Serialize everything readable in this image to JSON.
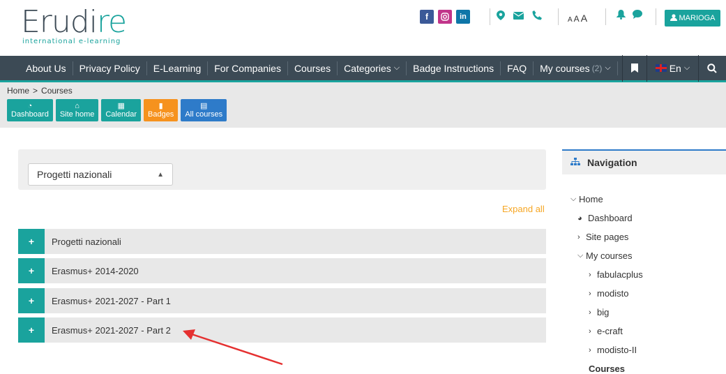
{
  "header": {
    "logo_main": "Erudire",
    "logo_sub": "international e-learning",
    "font_sizes_label": "AAA",
    "user_button": "MARIOGA"
  },
  "social_icons": [
    "facebook-icon",
    "instagram-icon",
    "linkedin-icon"
  ],
  "nav": {
    "items": [
      "About Us",
      "Privacy Policy",
      "E-Learning",
      "For Companies",
      "Courses",
      "Categories",
      "Badge Instructions",
      "FAQ",
      "My courses"
    ],
    "my_courses_count": "(2)",
    "language": "En"
  },
  "breadcrumb": {
    "home": "Home",
    "sep": ">",
    "current": "Courses"
  },
  "quick_links": {
    "dashboard": "Dashboard",
    "site_home": "Site home",
    "calendar": "Calendar",
    "badges": "Badges",
    "all_courses": "All courses"
  },
  "category_select": {
    "value": "Progetti nazionali"
  },
  "expand_all": "Expand all",
  "categories": [
    "Progetti nazionali",
    "Erasmus+ 2014-2020",
    "Erasmus+ 2021-2027 - Part 1",
    "Erasmus+ 2021-2027 - Part 2"
  ],
  "navigation_block": {
    "title": "Navigation",
    "home": "Home",
    "dashboard": "Dashboard",
    "site_pages": "Site pages",
    "my_courses": "My courses",
    "courses_list": [
      "fabulacplus",
      "modisto",
      "big",
      "e-craft",
      "modisto-II"
    ],
    "courses": "Courses"
  },
  "colors": {
    "teal": "#1aa39d",
    "navbar": "#3c4a55",
    "orange": "#f6921e",
    "blue": "#2e7bc9",
    "arrow": "#e53030"
  }
}
